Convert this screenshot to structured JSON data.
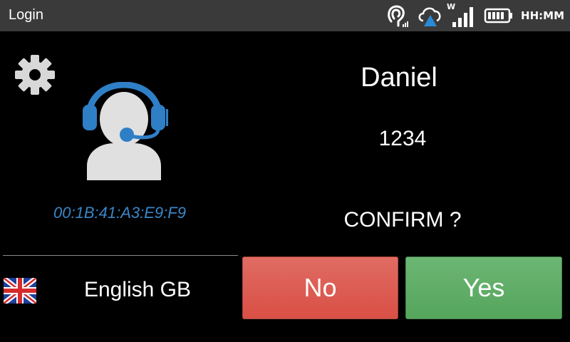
{
  "status_bar": {
    "title": "Login",
    "wifi_label": "W",
    "clock": "HH:MM",
    "icons": [
      "headset-signal-icon",
      "cloud-upload-icon",
      "cellular-signal-icon",
      "battery-icon"
    ]
  },
  "device": {
    "mac_address": "00:1B:41:A3:E9:F9",
    "language": "English GB",
    "flag_icon": "uk-flag-icon"
  },
  "user": {
    "name": "Daniel",
    "code": "1234"
  },
  "prompt": "CONFIRM ?",
  "buttons": {
    "no_label": "No",
    "yes_label": "Yes"
  },
  "colors": {
    "accent_blue": "#3a86c8",
    "no_red": "#d9534f",
    "yes_green": "#5cb85c",
    "statusbar_bg": "#3a3a3a"
  }
}
